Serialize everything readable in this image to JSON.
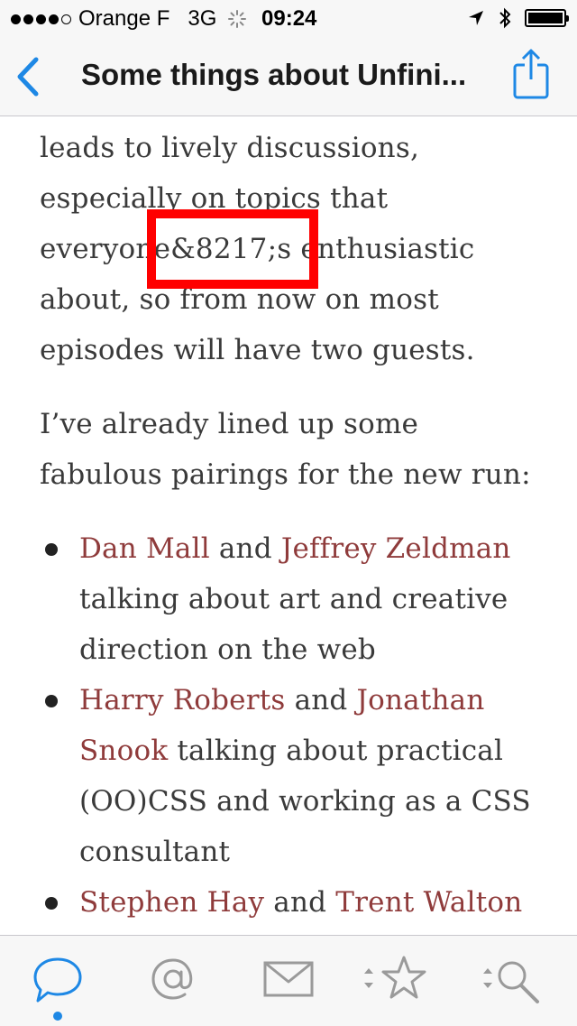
{
  "status_bar": {
    "carrier": "Orange F",
    "network": "3G",
    "time": "09:24"
  },
  "nav": {
    "title": "Some things about Unfini..."
  },
  "article": {
    "para1_lines": [
      "leads to lively discussions,",
      "especially on topics that",
      "everyone&8217;s enthusiastic",
      "about, so from now on most",
      "episodes will have two guests."
    ],
    "para2": "I’ve already lined up some fabulous pairings for the new run:",
    "list": [
      {
        "link1": "Dan Mall",
        "connector": " and ",
        "link2": "Jeffrey Zeldman",
        "text": " talking about art and creative direction on the web"
      },
      {
        "link1": "Harry Roberts",
        "connector": " and ",
        "link2": "Jonathan Snook",
        "text": " talking about practical (OO)CSS and working as a CSS consultant"
      },
      {
        "link1": "Stephen Hay",
        "connector": " and ",
        "link2": "Trent Walton",
        "text": ""
      }
    ]
  },
  "tabs": [
    {
      "name": "chat-bubble-icon",
      "active": true
    },
    {
      "name": "at-sign-icon",
      "active": false
    },
    {
      "name": "envelope-icon",
      "active": false
    },
    {
      "name": "star-icon",
      "active": false
    },
    {
      "name": "search-icon",
      "active": false
    }
  ],
  "colors": {
    "accent": "#1e88e5",
    "link": "#8f3b3b",
    "highlight_box": "#ff0000"
  }
}
